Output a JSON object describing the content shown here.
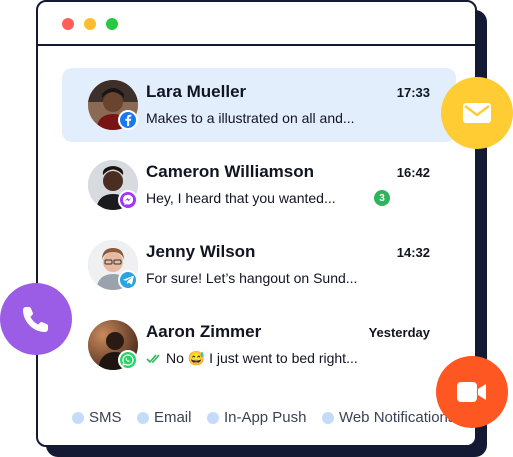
{
  "conversations": [
    {
      "name": "Lara Mueller",
      "time": "17:33",
      "preview": "Makes to a illustrated on all and...",
      "channel": "facebook-icon",
      "active": true
    },
    {
      "name": "Cameron Williamson",
      "time": "16:42",
      "preview": "Hey, I heard that you wanted...",
      "channel": "messenger-icon",
      "unread": "3"
    },
    {
      "name": "Jenny Wilson",
      "time": "14:32",
      "preview": "For sure! Let’s hangout on Sund...",
      "channel": "telegram-icon"
    },
    {
      "name": "Aaron Zimmer",
      "time": "Yesterday",
      "preview": "No 😅 I just went to bed right...",
      "channel": "whatsapp-icon",
      "read_status": "double-check-icon"
    }
  ],
  "channels": [
    "SMS",
    "Email",
    "In-App Push",
    "Web Notifications"
  ],
  "colors": {
    "frame": "#141a33",
    "active_row": "#e3eefc",
    "mail_fab": "#ffcc33",
    "phone_fab": "#9b5de5",
    "video_fab": "#ff5722",
    "unread_badge": "#2fb45a",
    "channel_bullet": "#c4dcf7"
  },
  "floating_icons": [
    "envelope-icon",
    "phone-icon",
    "video-camera-icon"
  ]
}
